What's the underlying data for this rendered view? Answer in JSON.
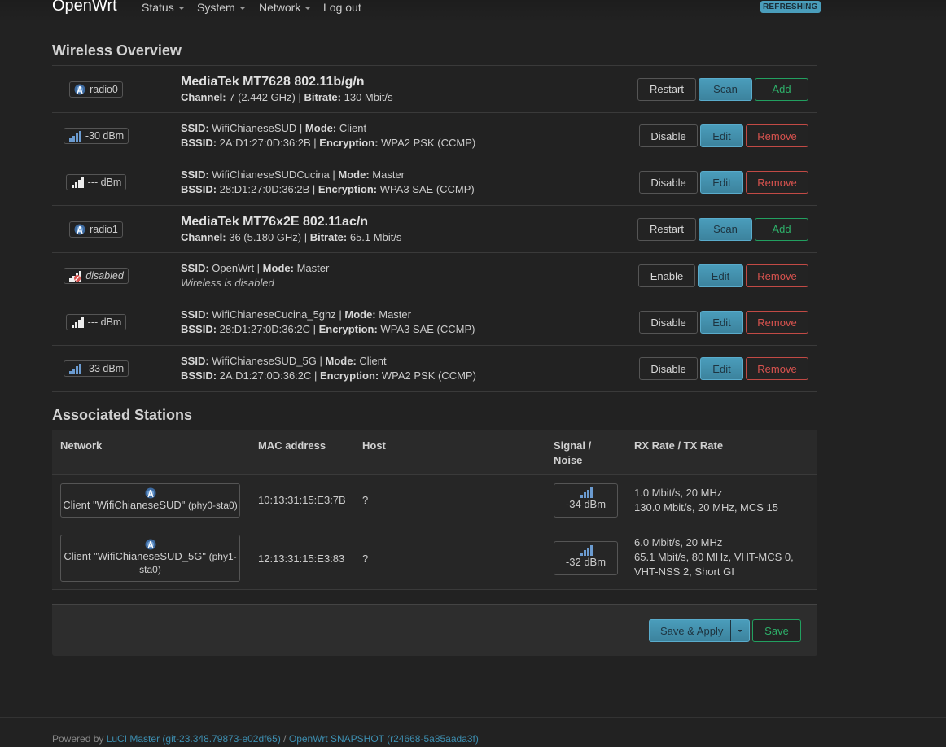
{
  "header": {
    "brand": "OpenWrt",
    "menu": [
      {
        "label": "Status",
        "dropdown": true
      },
      {
        "label": "System",
        "dropdown": true
      },
      {
        "label": "Network",
        "dropdown": true
      },
      {
        "label": "Log out",
        "dropdown": false
      }
    ],
    "refresh_badge": "REFRESHING"
  },
  "wireless_overview": {
    "title": "Wireless Overview",
    "rows": [
      {
        "type": "radio",
        "badge": "radio0",
        "icon": "wifi-radio-icon",
        "title": "MediaTek MT7628 802.11b/g/n",
        "line2": [
          {
            "k": "Channel:",
            "v": " 7 (2.442 GHz) | "
          },
          {
            "k": "Bitrate:",
            "v": " 130 Mbit/s"
          }
        ],
        "buttons": [
          "Restart",
          "Scan",
          "Add"
        ]
      },
      {
        "type": "net",
        "badge": "-30 dBm",
        "icon": "signal-strength-icon",
        "line1": [
          {
            "k": "SSID:",
            "v": " WifiChianeseSUD | "
          },
          {
            "k": "Mode:",
            "v": " Client"
          }
        ],
        "line2": [
          {
            "k": "BSSID:",
            "v": " 2A:D1:27:0D:36:2B | "
          },
          {
            "k": "Encryption:",
            "v": " WPA2 PSK (CCMP)"
          }
        ],
        "buttons": [
          "Disable",
          "Edit",
          "Remove"
        ]
      },
      {
        "type": "net",
        "badge": "--- dBm",
        "icon": "signal-none-icon",
        "line1": [
          {
            "k": "SSID:",
            "v": " WifiChianeseSUDCucina | "
          },
          {
            "k": "Mode:",
            "v": " Master"
          }
        ],
        "line2": [
          {
            "k": "BSSID:",
            "v": " 28:D1:27:0D:36:2B | "
          },
          {
            "k": "Encryption:",
            "v": " WPA3 SAE (CCMP)"
          }
        ],
        "buttons": [
          "Disable",
          "Edit",
          "Remove"
        ]
      },
      {
        "type": "radio",
        "badge": "radio1",
        "icon": "wifi-radio-icon",
        "title": "MediaTek MT76x2E 802.11ac/n",
        "line2": [
          {
            "k": "Channel:",
            "v": " 36 (5.180 GHz) | "
          },
          {
            "k": "Bitrate:",
            "v": " 65.1 Mbit/s"
          }
        ],
        "buttons": [
          "Restart",
          "Scan",
          "Add"
        ]
      },
      {
        "type": "net",
        "badge": "disabled",
        "icon": "signal-disabled-icon",
        "line1": [
          {
            "k": "SSID:",
            "v": " OpenWrt | "
          },
          {
            "k": "Mode:",
            "v": " Master"
          }
        ],
        "note": "Wireless is disabled",
        "buttons": [
          "Enable",
          "Edit",
          "Remove"
        ]
      },
      {
        "type": "net",
        "badge": "--- dBm",
        "icon": "signal-none-icon",
        "line1": [
          {
            "k": "SSID:",
            "v": " WifiChianeseCucina_5ghz | "
          },
          {
            "k": "Mode:",
            "v": " Master"
          }
        ],
        "line2": [
          {
            "k": "BSSID:",
            "v": " 28:D1:27:0D:36:2C | "
          },
          {
            "k": "Encryption:",
            "v": " WPA3 SAE (CCMP)"
          }
        ],
        "buttons": [
          "Disable",
          "Edit",
          "Remove"
        ]
      },
      {
        "type": "net",
        "badge": "-33 dBm",
        "icon": "signal-strength-icon",
        "line1": [
          {
            "k": "SSID:",
            "v": " WifiChianeseSUD_5G | "
          },
          {
            "k": "Mode:",
            "v": " Client"
          }
        ],
        "line2": [
          {
            "k": "BSSID:",
            "v": " 2A:D1:27:0D:36:2C | "
          },
          {
            "k": "Encryption:",
            "v": " WPA2 PSK (CCMP)"
          }
        ],
        "buttons": [
          "Disable",
          "Edit",
          "Remove"
        ]
      }
    ]
  },
  "associated_stations": {
    "title": "Associated Stations",
    "columns": [
      "Network",
      "MAC address",
      "Host",
      "Signal / Noise",
      "RX Rate / TX Rate"
    ],
    "rows": [
      {
        "network_main": "Client \"WifiChianeseSUD\"",
        "network_dev": "(phy0-sta0)",
        "mac": "10:13:31:15:E3:7B",
        "host": "?",
        "signal": "-34 dBm",
        "rates": [
          "1.0 Mbit/s, 20 MHz",
          "130.0 Mbit/s, 20 MHz, MCS 15"
        ]
      },
      {
        "network_main": "Client \"WifiChianeseSUD_5G\"",
        "network_dev": "(phy1-sta0)",
        "mac": "12:13:31:15:E3:83",
        "host": "?",
        "signal": "-32 dBm",
        "rates": [
          "6.0 Mbit/s, 20 MHz",
          "65.1 Mbit/s, 80 MHz, VHT-MCS 0,",
          "VHT-NSS 2, Short GI"
        ]
      }
    ]
  },
  "actions": {
    "save_apply": "Save & Apply",
    "save": "Save"
  },
  "footer": {
    "prefix": "Powered by ",
    "luci_link": "LuCI Master (git-23.348.79873-e02df65)",
    "separator": " / ",
    "openwrt_link": "OpenWrt SNAPSHOT (r24668-5a85aada3f)"
  },
  "colors": {
    "background": "#222222",
    "primary": "#4a9dbb",
    "positive": "#2eb06a",
    "negative": "#d9534f",
    "link": "#3d8eb0"
  }
}
